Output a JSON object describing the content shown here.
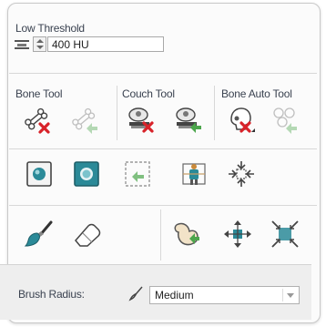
{
  "threshold": {
    "label": "Low Threshold",
    "value": "400 HU"
  },
  "groups": {
    "bone_tool": "Bone Tool",
    "couch_tool": "Couch Tool",
    "bone_auto_tool": "Bone Auto Tool"
  },
  "brush": {
    "label": "Brush Radius:",
    "selected": "Medium"
  },
  "colors": {
    "accent_teal": "#2b8a98",
    "delete_red": "#d8232a",
    "arrow_green": "#4ca64c"
  }
}
